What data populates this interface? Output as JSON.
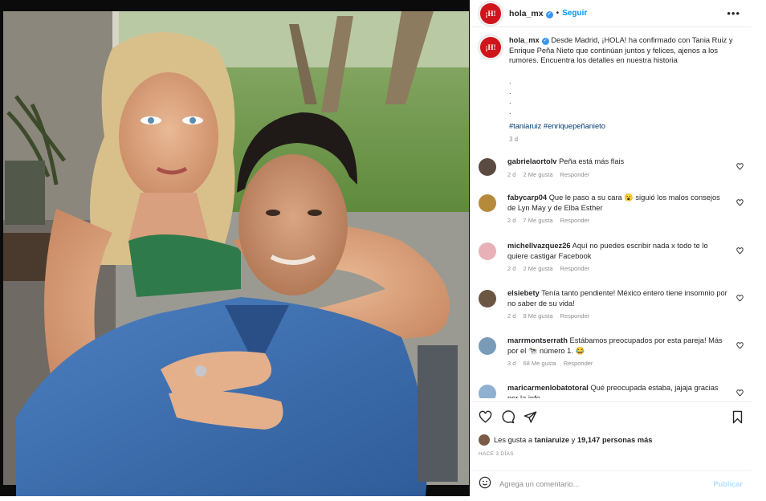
{
  "post": {
    "username": "hola_mx",
    "verified_glyph": "✓",
    "separator": "•",
    "follow_label": "Seguir",
    "more_label": "•••",
    "avatar_text": "¡H!"
  },
  "caption": {
    "username": "hola_mx",
    "text": "Desde Madrid, ¡HOLA! ha confirmado con Tania Ruiz y Enrique Peña Nieto que continúan juntos y felices, ajenos a los rumores. Encuentra los detalles en nuestra historia",
    "dots": [
      ".",
      ".",
      ".",
      "."
    ],
    "hashtags": "#taniaruiz #enriquepeñanieto",
    "time": "3 d"
  },
  "comments": [
    {
      "username": "gabrielaortolv",
      "text": "Peña está más flais",
      "time": "2 d",
      "likes": "2 Me gusta",
      "reply": "Responder",
      "avatar_color": "#5a4a42"
    },
    {
      "username": "fabycarp04",
      "text": "Que le paso a su cara 😮 siguió los malos consejos de Lyn May y de Elba Esther",
      "time": "2 d",
      "likes": "7 Me gusta",
      "reply": "Responder",
      "avatar_color": "#b58a3c"
    },
    {
      "username": "michellvazquez26",
      "text": "Aquí no puedes escribir nada x todo te lo quiere castigar Facebook",
      "time": "2 d",
      "likes": "2 Me gusta",
      "reply": "Responder",
      "avatar_color": "#e8b1b8"
    },
    {
      "username": "elsiebety",
      "text": "Tenía tanto pendiente! México entero tiene insomnio por no saber de su vida!",
      "time": "2 d",
      "likes": "8 Me gusta",
      "reply": "Responder",
      "avatar_color": "#6b5543"
    },
    {
      "username": "marrmontserrath",
      "text": "Estábamos preocupados por esta pareja! Más por el 🐄 número 1. 😂",
      "time": "3 d",
      "likes": "68 Me gusta",
      "reply": "Responder",
      "avatar_color": "#7a9bb8"
    },
    {
      "username": "maricarmenlobatotoral",
      "text": "Qué preocupada estaba, jajaja gracias por la info",
      "time": "",
      "likes": "",
      "reply": "",
      "avatar_color": "#8fb0cf"
    }
  ],
  "actions": {
    "likes_prefix": "Les gusta a ",
    "liked_by": "taniaruize",
    "likes_middle": " y ",
    "likes_count": "19,147 personas más",
    "post_date": "HACE 3 DÍAS",
    "comment_placeholder": "Agrega un comentario...",
    "publish_label": "Publicar"
  },
  "colors": {
    "brand_red": "#d0141c",
    "link_blue": "#0095f6",
    "hashtag_navy": "#00376b",
    "muted_gray": "#8e8e8e",
    "publish_disabled": "#b2dffc"
  },
  "icons": [
    "heart-icon",
    "comment-icon",
    "share-icon",
    "bookmark-icon",
    "emoji-icon",
    "verified-badge-icon",
    "more-options-icon"
  ]
}
